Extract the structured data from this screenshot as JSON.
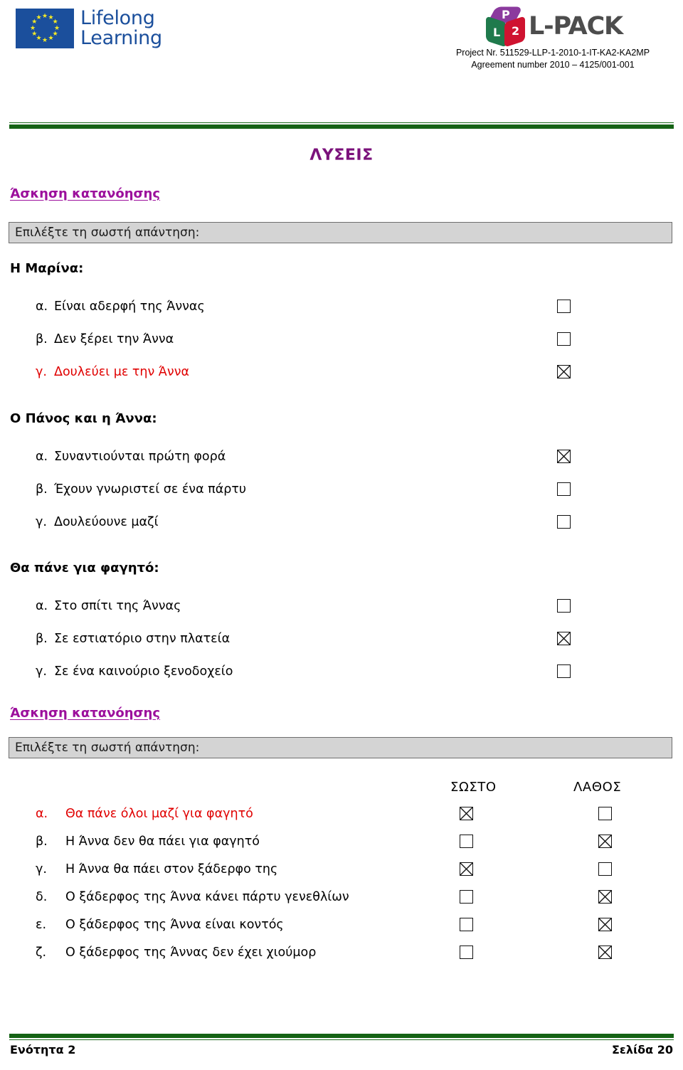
{
  "header": {
    "eu_logo": {
      "line1": "Lifelong",
      "line2": "Learning",
      "alt": "eu-lifelong-learning-logo"
    },
    "lpack_logo": {
      "cube_top_letter": "P",
      "cube_left_letter": "L",
      "cube_right_letter": "2",
      "wordmark": "L-PACK"
    },
    "project_line_1": "Project Nr. 511529-LLP-1-2010-1-IT-KA2-KA2MP",
    "project_line_2": "Agreement number 2010 – 4125/001-001"
  },
  "page": {
    "title": "ΛΥΣΕΙΣ"
  },
  "colors": {
    "title_purple": "#7b127b",
    "heading_purple": "#9c109c",
    "answer_red": "#e00000",
    "rule_green": "#156315",
    "bar_gray": "#d4d4d4",
    "eu_blue": "#1b4f9c",
    "cube_purple": "#8b3a9e",
    "cube_green": "#1f7a4c",
    "cube_red": "#cf1330",
    "lpack_gray": "#4d4d4d"
  },
  "exercise1": {
    "heading": "Άσκηση κατανόησης",
    "instruction": "Επιλέξτε τη σωστή απάντηση:",
    "questions": [
      {
        "title": "Η Μαρίνα:",
        "options": [
          {
            "letter": "α.",
            "text": "Είναι αδερφή της Άννας",
            "checked": false,
            "red": false
          },
          {
            "letter": "β.",
            "text": "Δεν ξέρει την Άννα",
            "checked": false,
            "red": false
          },
          {
            "letter": "γ.",
            "text": "Δουλεύει με την Άννα",
            "checked": true,
            "red": true
          }
        ]
      },
      {
        "title": "Ο Πάνος και η Άννα:",
        "options": [
          {
            "letter": "α.",
            "text": "Συναντιούνται πρώτη φορά",
            "checked": true,
            "red": false
          },
          {
            "letter": "β.",
            "text": "Έχουν γνωριστεί σε ένα πάρτυ",
            "checked": false,
            "red": false
          },
          {
            "letter": "γ.",
            "text": "Δουλεύουνε μαζί",
            "checked": false,
            "red": false
          }
        ]
      },
      {
        "title": "Θα πάνε για φαγητό:",
        "options": [
          {
            "letter": "α.",
            "text": "Στο σπίτι της Άννας",
            "checked": false,
            "red": false
          },
          {
            "letter": "β.",
            "text": "Σε εστιατόριο στην πλατεία",
            "checked": true,
            "red": false
          },
          {
            "letter": "γ.",
            "text": "Σε ένα καινούριο ξενοδοχείο",
            "checked": false,
            "red": false
          }
        ]
      }
    ]
  },
  "exercise2": {
    "heading": "Άσκηση κατανόησης",
    "instruction": "Επιλέξτε τη σωστή απάντηση:",
    "col_true": "ΣΩΣΤΟ",
    "col_false": "ΛΑΘΟΣ",
    "rows": [
      {
        "letter": "α.",
        "text": "Θα πάνε όλοι μαζί για φαγητό",
        "true_checked": true,
        "false_checked": false,
        "red": true
      },
      {
        "letter": "β.",
        "text": "Η Άννα δεν θα πάει για φαγητό",
        "true_checked": false,
        "false_checked": true,
        "red": false
      },
      {
        "letter": "γ.",
        "text": "Η Άννα θα πάει στον ξάδερφο της",
        "true_checked": true,
        "false_checked": false,
        "red": false
      },
      {
        "letter": "δ.",
        "text": "Ο ξάδερφος της Άννα κάνει πάρτυ γενεθλίων",
        "true_checked": false,
        "false_checked": true,
        "red": false
      },
      {
        "letter": "ε.",
        "text": "Ο ξάδερφος της Άννα είναι κοντός",
        "true_checked": false,
        "false_checked": true,
        "red": false
      },
      {
        "letter": "ζ.",
        "text": "Ο ξάδερφος της Άννας δεν έχει χιούμορ",
        "true_checked": false,
        "false_checked": true,
        "red": false
      }
    ]
  },
  "footer": {
    "left": "Ενότητα 2",
    "right": "Σελίδα 20"
  }
}
